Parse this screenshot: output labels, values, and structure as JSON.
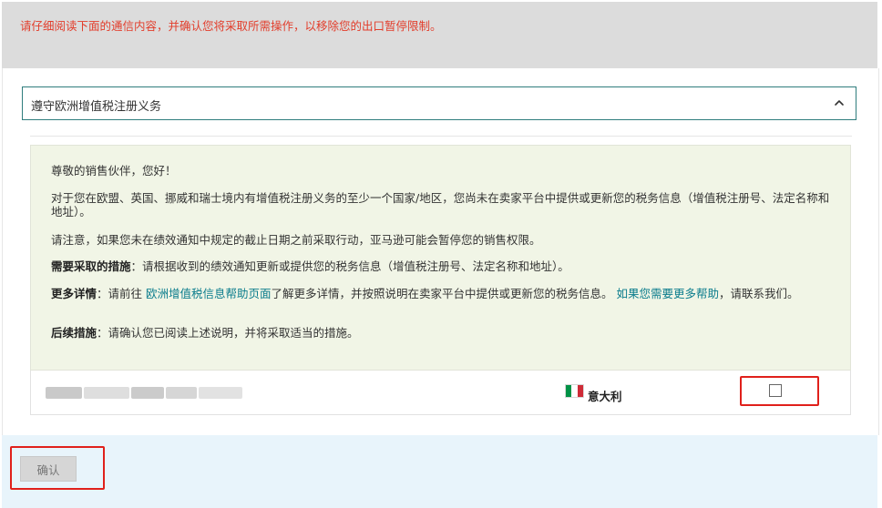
{
  "notice": {
    "text": "请仔细阅读下面的通信内容，并确认您将采取所需操作，以移除您的出口暂停限制。"
  },
  "accordion": {
    "title": "遵守欧洲增值税注册义务",
    "expanded": true,
    "icon": "chevron-up-icon"
  },
  "message": {
    "greeting": "尊敬的销售伙伴，您好！",
    "para1": "对于您在欧盟、英国、挪威和瑞士境内有增值税注册义务的至少一个国家/地区，您尚未在卖家平台中提供或更新您的税务信息（增值税注册号、法定名称和地址）。",
    "para2": "请注意，如果您未在绩效通知中规定的截止日期之前采取行动，亚马逊可能会暂停您的销售权限。",
    "action_label": "需要采取的措施",
    "action_text": "：请根据收到的绩效通知更新或提供您的税务信息（增值税注册号、法定名称和地址）。",
    "details_label": "更多详情",
    "details_text_1": "：请前往 ",
    "details_link_1": "欧洲增值税信息帮助页面",
    "details_text_2": "了解更多详情，并按照说明在卖家平台中提供或更新您的税务信息。 ",
    "details_link_2": "如果您需要更多帮助",
    "details_text_3": "，请联系我们。",
    "followup_label": "后续措施",
    "followup_text": "：请确认您已阅读上述说明，并将采取适当的措施。"
  },
  "country_row": {
    "country_name": "意大利",
    "flag_colors": [
      "#009246",
      "#ffffff",
      "#ce2b37"
    ],
    "checked": false
  },
  "actions": {
    "confirm_label": "确认"
  },
  "colors": {
    "notice_red": "#e23d2b",
    "accent_teal": "#2f7d7d",
    "link_teal": "#0a7c8c",
    "highlight_red": "#e0201b",
    "panel_bg": "#f1f5e6"
  }
}
